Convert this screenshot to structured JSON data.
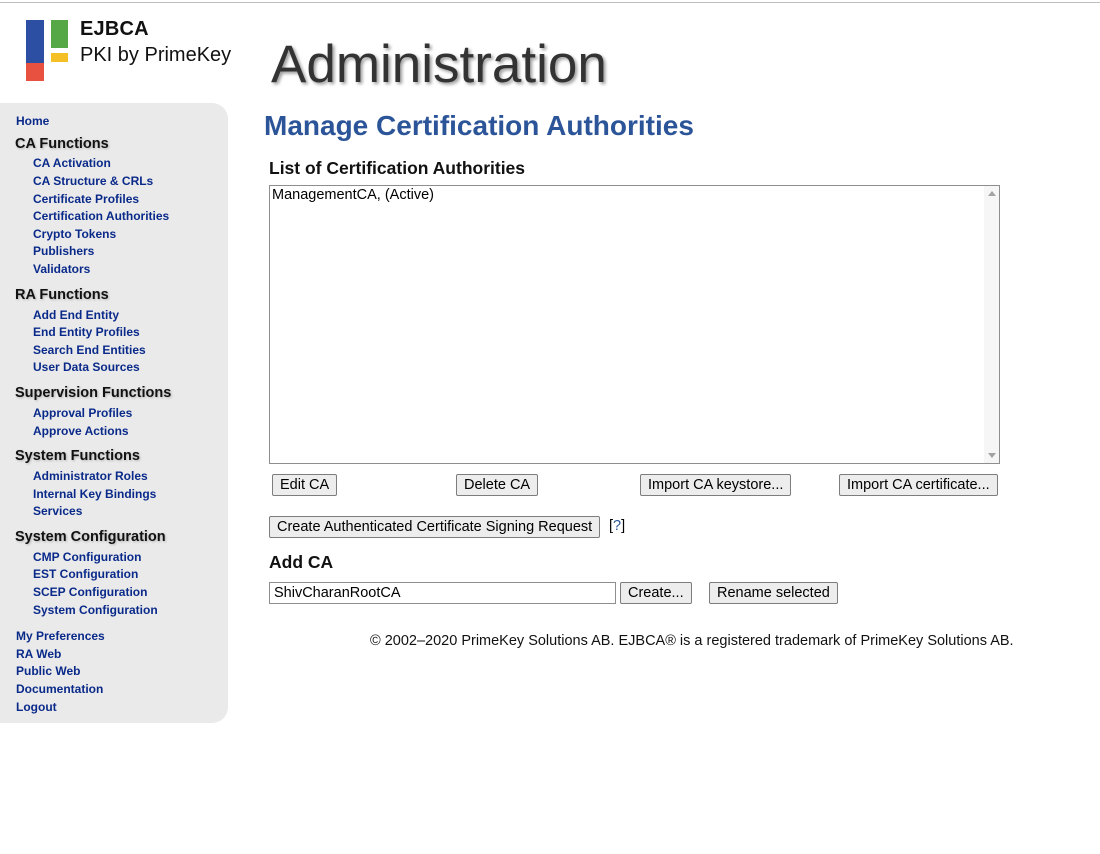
{
  "logo": {
    "brand_line1": "EJBCA",
    "brand_line2": "PKI by PrimeKey"
  },
  "header": {
    "title": "Administration"
  },
  "sidebar": {
    "home": "Home",
    "ca_functions": {
      "heading": "CA Functions",
      "items": [
        "CA Activation",
        "CA Structure & CRLs",
        "Certificate Profiles",
        "Certification Authorities",
        "Crypto Tokens",
        "Publishers",
        "Validators"
      ]
    },
    "ra_functions": {
      "heading": "RA Functions",
      "items": [
        "Add End Entity",
        "End Entity Profiles",
        "Search End Entities",
        "User Data Sources"
      ]
    },
    "supervision_functions": {
      "heading": "Supervision Functions",
      "items": [
        "Approval Profiles",
        "Approve Actions"
      ]
    },
    "system_functions": {
      "heading": "System Functions",
      "items": [
        "Administrator Roles",
        "Internal Key Bindings",
        "Services"
      ]
    },
    "system_configuration": {
      "heading": "System Configuration",
      "items": [
        "CMP Configuration",
        "EST Configuration",
        "SCEP Configuration",
        "System Configuration"
      ]
    },
    "bottom_links": [
      "My Preferences",
      "RA Web",
      "Public Web",
      "Documentation",
      "Logout"
    ]
  },
  "main": {
    "page_title": "Manage Certification Authorities",
    "list_heading": "List of Certification Authorities",
    "ca_list": [
      "ManagementCA, (Active)"
    ],
    "buttons": {
      "edit": "Edit CA",
      "delete": "Delete CA",
      "import_keystore": "Import CA keystore...",
      "import_certificate": "Import CA certificate...",
      "create_csr": "Create Authenticated Certificate Signing Request",
      "create": "Create...",
      "rename": "Rename selected"
    },
    "help": {
      "open": "[",
      "link": "?",
      "close": "]"
    },
    "add_heading": "Add CA",
    "ca_name_value": "ShivCharanRootCA"
  },
  "footer": {
    "text": "© 2002–2020 PrimeKey Solutions AB. EJBCA® is a registered trademark of PrimeKey Solutions AB."
  },
  "colors": {
    "accent": "#2b5598",
    "nav_link": "#0a2a8a",
    "sidebar_bg": "#eaeaea"
  }
}
